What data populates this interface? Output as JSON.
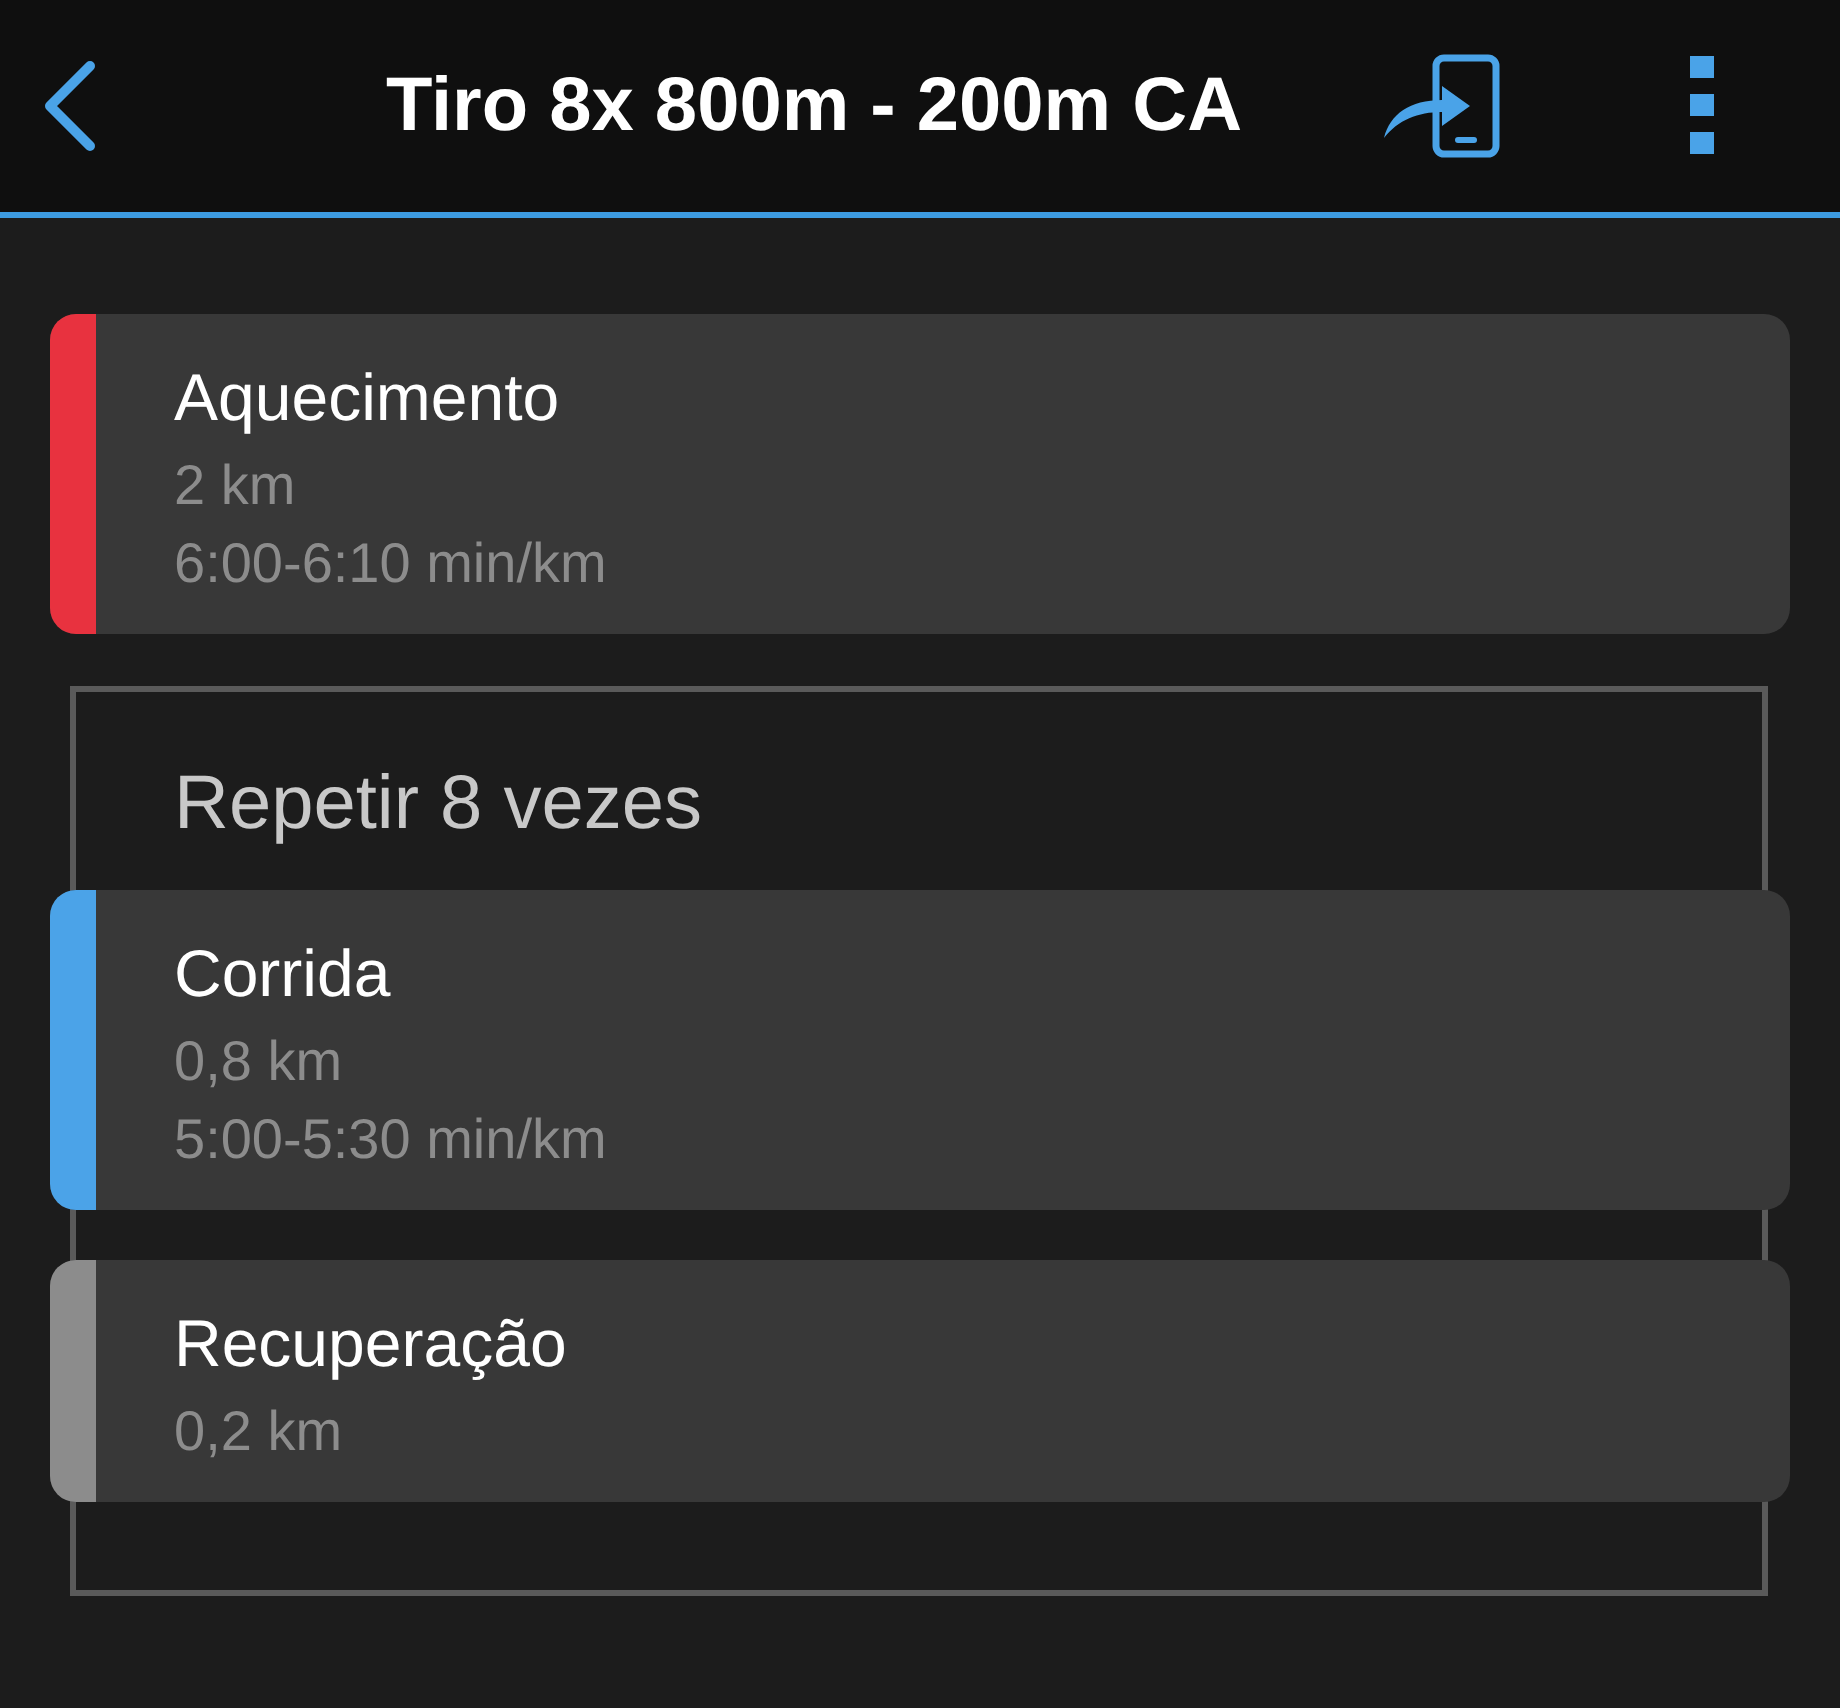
{
  "header": {
    "title": "Tiro 8x 800m - 200m CA"
  },
  "workout": [
    {
      "kind": "step",
      "name": "Aquecimento",
      "color": "#e8323f",
      "distance": "2 km",
      "pace": "6:00-6:10 min/km"
    },
    {
      "kind": "repeat",
      "label": "Repetir 8 vezes",
      "steps": [
        {
          "kind": "step",
          "name": "Corrida",
          "color": "#4ba3e8",
          "distance": "0,8 km",
          "pace": "5:00-5:30 min/km"
        },
        {
          "kind": "step",
          "name": "Recuperação",
          "color": "#8c8c8c",
          "distance": "0,2 km"
        }
      ]
    }
  ]
}
